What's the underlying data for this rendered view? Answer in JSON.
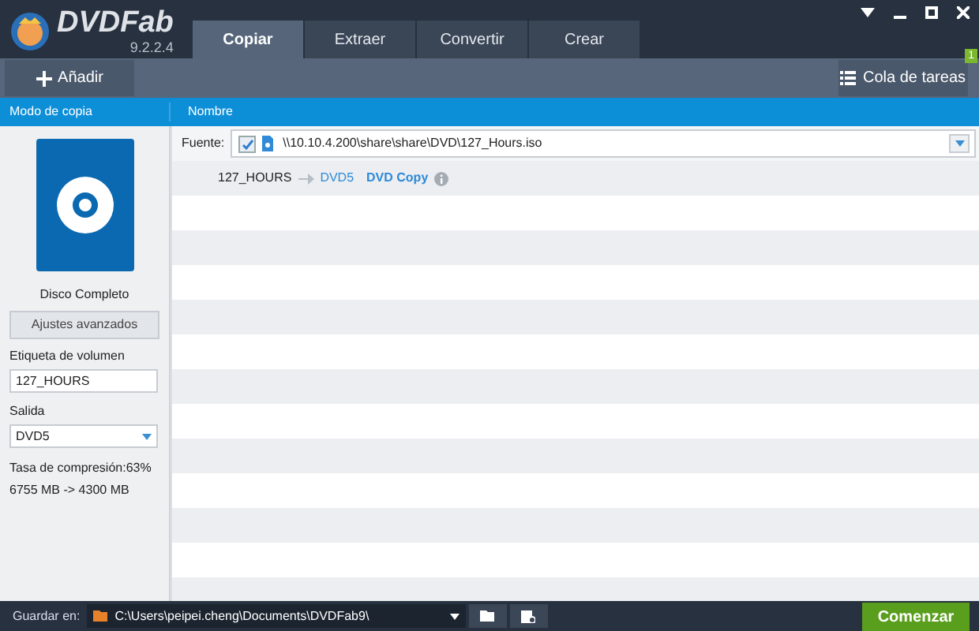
{
  "app": {
    "name": "DVDFab",
    "version": "9.2.2.4"
  },
  "tabs": [
    {
      "label": "Copiar",
      "selected": true
    },
    {
      "label": "Extraer",
      "selected": false
    },
    {
      "label": "Convertir",
      "selected": false
    },
    {
      "label": "Crear",
      "selected": false
    }
  ],
  "toolbar": {
    "add_button": "Añadir",
    "queue_button": "Cola de tareas",
    "queue_count": "1"
  },
  "left_panel": {
    "header": "Modo de copia",
    "mode": "Disco Completo",
    "advanced_button": "Ajustes avanzados",
    "volume_label": {
      "label": "Etiqueta de volumen",
      "value": "127_HOURS"
    },
    "output": {
      "label": "Salida",
      "value": "DVD5"
    },
    "compression": "Tasa de compresión:63%",
    "size": "6755 MB -> 4300 MB"
  },
  "list": {
    "column": "Nombre",
    "source": {
      "label": "Fuente:",
      "checked": true,
      "path": "\\\\10.10.4.200\\share\\share\\DVD\\127_Hours.iso"
    },
    "items": [
      {
        "title": "127_HOURS",
        "target": "DVD5",
        "mode": "DVD Copy"
      }
    ]
  },
  "footer": {
    "save_label": "Guardar en:",
    "path": "C:\\Users\\peipei.cheng\\Documents\\DVDFab9\\",
    "start_button": "Comenzar"
  }
}
